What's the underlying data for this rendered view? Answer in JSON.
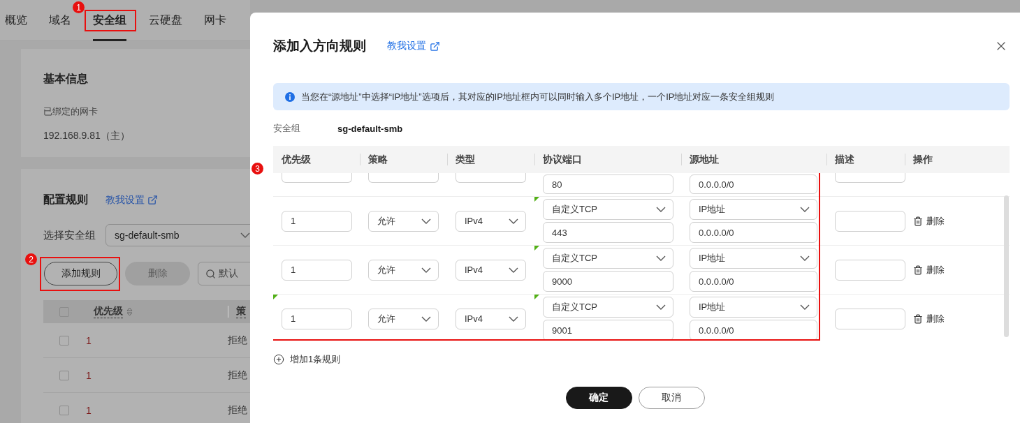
{
  "page": {
    "tabs": [
      {
        "label": "概览",
        "selected": false
      },
      {
        "label": "域名",
        "selected": false
      },
      {
        "label": "安全组",
        "selected": true,
        "callout": "1"
      },
      {
        "label": "云硬盘",
        "selected": false
      },
      {
        "label": "网卡",
        "selected": false
      }
    ],
    "basic_info": {
      "title": "基本信息",
      "label": "已绑定的网卡",
      "value": "192.168.9.81（主）"
    },
    "rules": {
      "title": "配置规则",
      "help_link": "教我设置",
      "select_label": "选择安全组",
      "select_value": "sg-default-smb",
      "add_button": {
        "label": "添加规则",
        "callout": "2"
      },
      "delete_button": {
        "label": "删除",
        "disabled": true
      },
      "search": {
        "placeholder": "默认"
      },
      "table": {
        "select_all": false,
        "columns": [
          "优先级",
          "策"
        ],
        "rows": [
          {
            "checked": false,
            "priority": "1",
            "policy": "拒绝"
          },
          {
            "checked": false,
            "priority": "1",
            "policy": "拒绝"
          },
          {
            "checked": false,
            "priority": "1",
            "policy": "拒绝"
          }
        ]
      }
    }
  },
  "dialog": {
    "title": "添加入方向规则",
    "help_link": "教我设置",
    "notice": "当您在“源地址”中选择“IP地址”选项后，其对应的IP地址框内可以同时输入多个IP地址，一个IP地址对应一条安全组规则",
    "group_label": "安全组",
    "group_value": "sg-default-smb",
    "columns": [
      "优先级",
      "策略",
      "类型",
      "协议端口",
      "源地址",
      "描述",
      "操作"
    ],
    "callout": "3",
    "rows": [
      {
        "kind": "partial",
        "port": "80",
        "source": "0.0.0.0/0"
      },
      {
        "kind": "full",
        "priority": "1",
        "policy": "允许",
        "type": "IPv4",
        "protocol": "自定义TCP",
        "port": "443",
        "source_type": "IP地址",
        "source": "0.0.0.0/0",
        "action": "删除",
        "priority_marked": false,
        "port_marked": true
      },
      {
        "kind": "full",
        "priority": "1",
        "policy": "允许",
        "type": "IPv4",
        "protocol": "自定义TCP",
        "port": "9000",
        "source_type": "IP地址",
        "source": "0.0.0.0/0",
        "action": "删除",
        "priority_marked": false,
        "port_marked": true
      },
      {
        "kind": "full",
        "priority": "1",
        "policy": "允许",
        "type": "IPv4",
        "protocol": "自定义TCP",
        "port": "9001",
        "source_type": "IP地址",
        "source": "0.0.0.0/0",
        "action": "删除",
        "priority_marked": true,
        "port_marked": true
      }
    ],
    "add_row": "增加1条规则",
    "confirm": "确定",
    "cancel": "取消"
  }
}
